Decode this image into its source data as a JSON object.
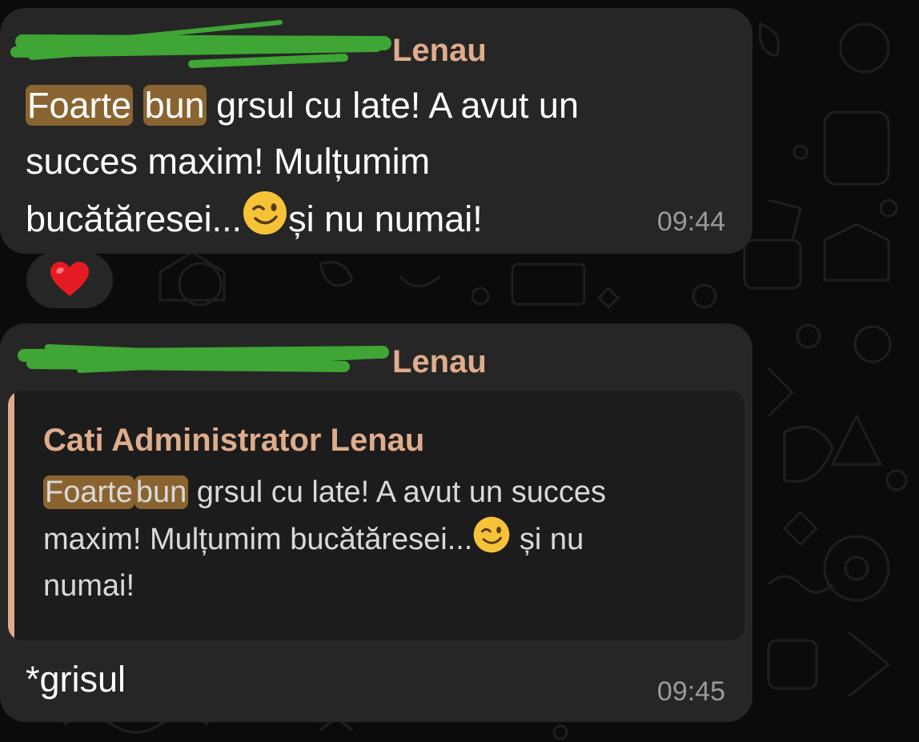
{
  "messages": [
    {
      "sender_visible": "Lenau",
      "text": {
        "highlight_1": "Foarte",
        "highlight_2": "bun",
        "line1_rest": " grsul cu late! A avut un",
        "line2": "succes maxim! Mulțumim",
        "line3_start": "bucătăresei...",
        "line3_end": "și nu numai!"
      },
      "time": "09:44",
      "reaction": {
        "icon": "heart-emoji"
      }
    },
    {
      "sender_visible": "Lenau",
      "quote": {
        "sender": "Cati Administrator Lenau",
        "highlight_1": "Foarte",
        "highlight_2": "bun",
        "rest_1": " grsul cu late! A avut un succes",
        "rest_2": "maxim! Mulțumim bucătăresei...",
        "rest_3": " și nu",
        "rest_4": "numai!"
      },
      "text": "*grisul",
      "time": "09:45"
    }
  ],
  "colors": {
    "background": "#0b0b0b",
    "bubble": "#262626",
    "quote_bg": "#1c1c1c",
    "sender": "#dfac8c",
    "highlight": "#8a6430",
    "redaction": "#3fa535",
    "timestamp": "#9a9a9a"
  }
}
